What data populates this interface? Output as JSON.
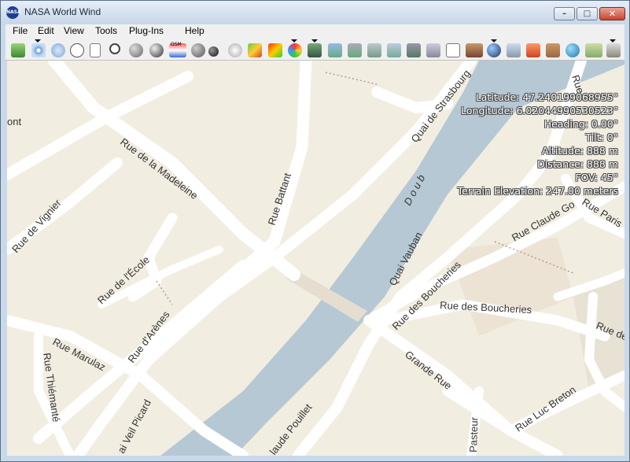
{
  "window": {
    "title": "NASA World Wind",
    "icon_text": "NASA",
    "minimize_glyph": "–",
    "maximize_glyph": "□",
    "close_glyph": "✕"
  },
  "menu": [
    "File",
    "Edit",
    "View",
    "Tools",
    "Plug-Ins",
    "Help"
  ],
  "toolbar": {
    "icons": [
      "layer-stack-icon",
      "crosshair-icon",
      "latlon-grid-icon",
      "compass-icon",
      "scale-bar-icon",
      "magnifier-icon",
      "blue-marble-icon",
      "earth-globe-icon",
      "landsat-image-icon",
      "moon-globe-icon",
      "dark-globe-icon",
      "cloud-layer-icon",
      "usgs-topo-icon",
      "color-relief-icon",
      "rainbow-icon",
      "zoomit-icon",
      "terra-image-icon",
      "aqua-image-icon",
      "modis-image-icon",
      "seasonal-image-icon",
      "landcover-icon",
      "gazetteer-icon",
      "place-names-icon",
      "satellite-icon",
      "globe-view-icon",
      "tile-icon",
      "pdf-icon",
      "brick-icon",
      "world-icon",
      "map-icon",
      "download-icon"
    ],
    "map_label": "OSM"
  },
  "overlay": {
    "latitude": "Latitude: 47.240199068955°",
    "longitude": "Longitude: 6.02044990530523°",
    "heading": "Heading: 0.00°",
    "tilt": "Tilt: 0°",
    "altitude": "Altitude: 888 m",
    "distance": "Distance: 888 m",
    "fov": "FOV: 45°",
    "terrain_elevation": "Terrain Elevation: 247.00 meters"
  },
  "map": {
    "river_name": "D o u b",
    "streets": {
      "quai_strasbourg": "Quai de Strasbourg",
      "rue_madeleine": "Rue de la Madeleine",
      "rue_battant": "Rue Battant",
      "rue_vignier": "Rue de Vignier",
      "rue_ecole": "Rue de l'École",
      "rue_arenes": "Rue d'Arènes",
      "rue_marulaz": "Rue Marulaz",
      "rue_thiemante": "Rue Thiémanté",
      "veil_picard": "ai Veil Picard",
      "quai_vauban": "Quai Vauban",
      "rue_boucheries_1": "Rue des Boucheries",
      "rue_boucheries_2": "Rue des Boucheries",
      "rue_claude": "Rue Claude Go",
      "rue_paris": "Rue Paris",
      "grande_rue": "Grande Rue",
      "rue_luc_breton": "Rue Luc Breton",
      "pasteur": "Pasteur",
      "claude_pouillet": "laude Pouillet",
      "ont": "ont",
      "rue_top_right": "Rue",
      "rue_right": "Rue de"
    }
  }
}
